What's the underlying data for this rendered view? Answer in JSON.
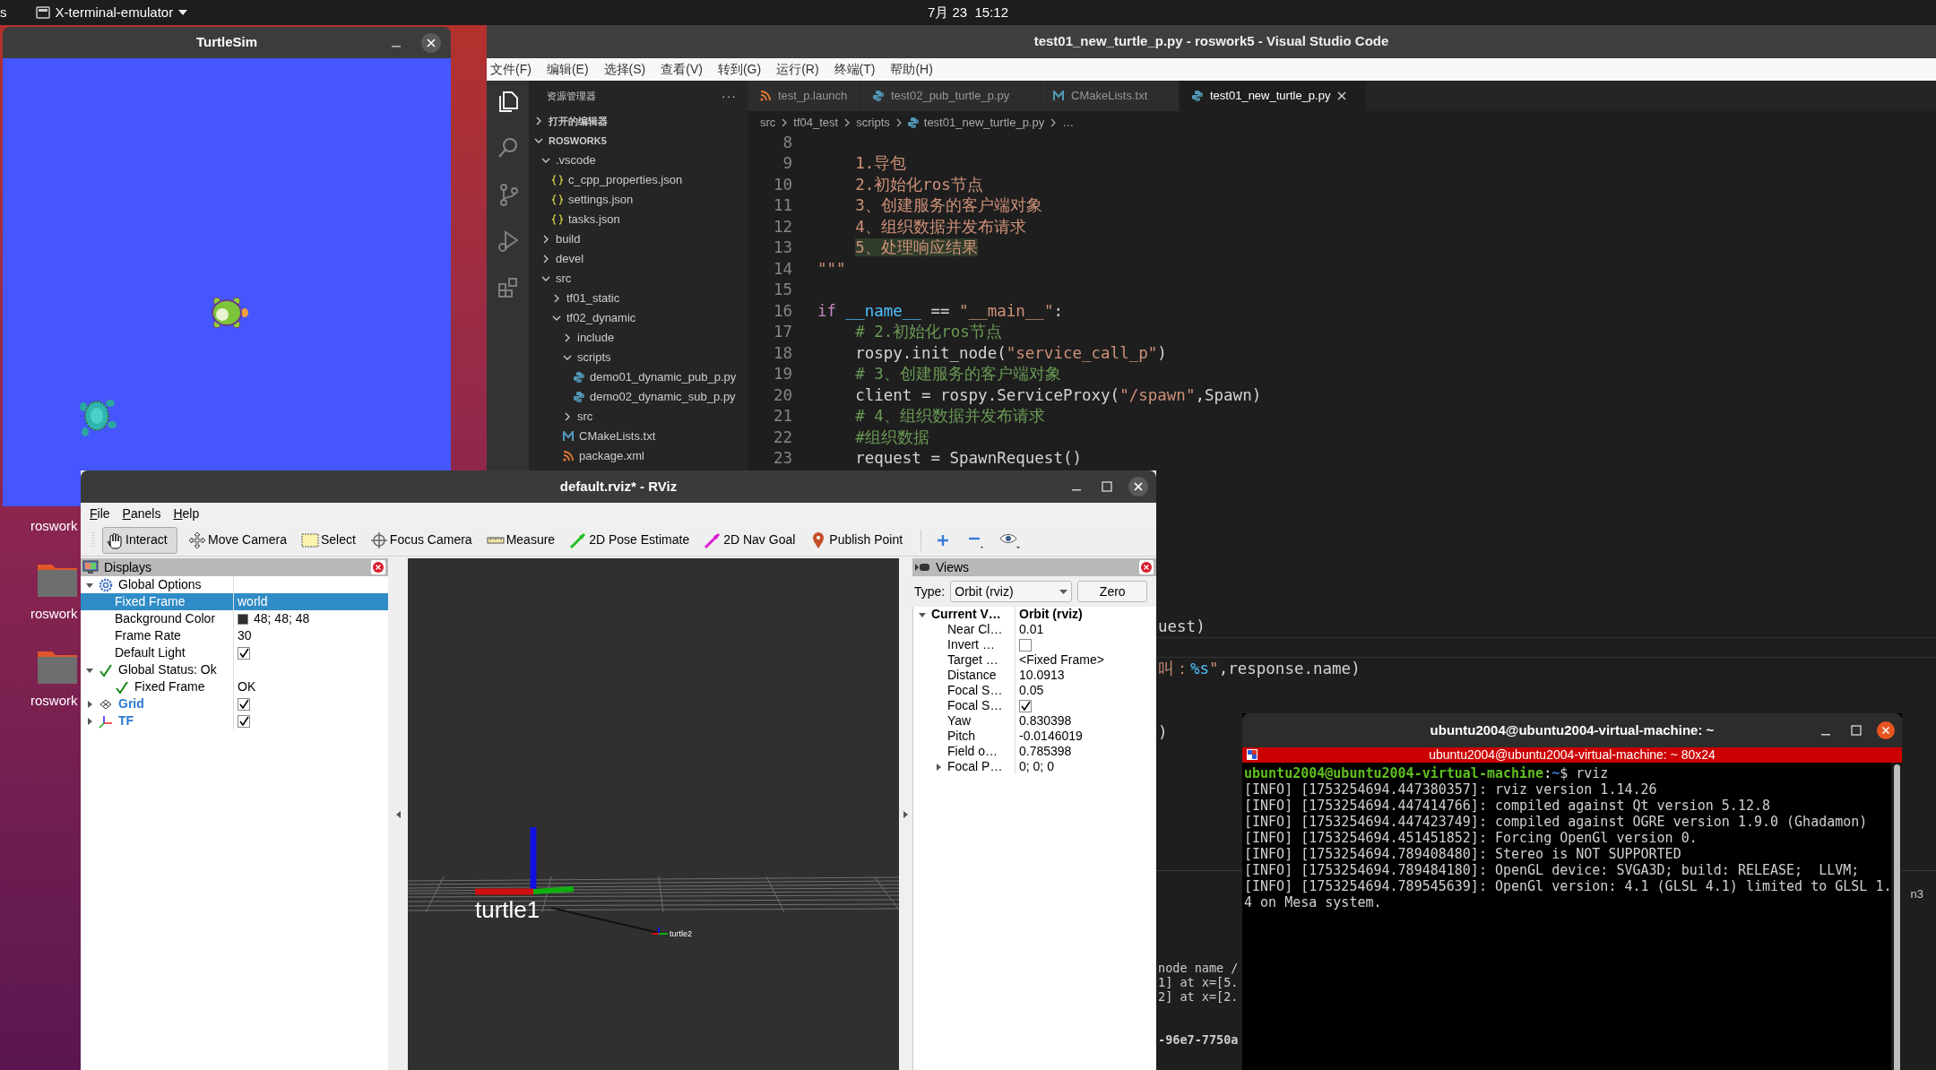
{
  "top_bar": {
    "activities": "s",
    "app_menu": "X-terminal-emulator",
    "clock": "7月 23  15:12"
  },
  "desktop_icons": [
    {
      "label": "roswork",
      "folder": false
    },
    {
      "label": "roswork",
      "folder": true
    },
    {
      "label": "roswork",
      "folder": true
    }
  ],
  "turtlesim": {
    "title": "TurtleSim"
  },
  "vscode": {
    "title": "test01_new_turtle_p.py - roswork5 - Visual Studio Code",
    "menu": [
      "文件(F)",
      "编辑(E)",
      "选择(S)",
      "查看(V)",
      "转到(G)",
      "运行(R)",
      "终端(T)",
      "帮助(H)"
    ],
    "activity": [
      {
        "kind": "files",
        "selected": true
      },
      {
        "kind": "search",
        "selected": false
      },
      {
        "kind": "branch",
        "selected": false
      },
      {
        "kind": "run",
        "selected": false
      },
      {
        "kind": "extensions",
        "selected": false
      }
    ],
    "explorer_title": "资源管理器",
    "more": "···",
    "open_editors": "打开的编辑器",
    "workspace": "ROSWORK5",
    "tree": [
      {
        "label": ".vscode",
        "kind": "folder",
        "expanded": true,
        "children": [
          {
            "label": "c_cpp_properties.json",
            "kind": "json"
          },
          {
            "label": "settings.json",
            "kind": "json"
          },
          {
            "label": "tasks.json",
            "kind": "json"
          }
        ]
      },
      {
        "label": "build",
        "kind": "folder",
        "expanded": false
      },
      {
        "label": "devel",
        "kind": "folder",
        "expanded": false
      },
      {
        "label": "src",
        "kind": "folder",
        "expanded": true,
        "children": [
          {
            "label": "tf01_static",
            "kind": "folder",
            "expanded": false
          },
          {
            "label": "tf02_dynamic",
            "kind": "folder",
            "expanded": true,
            "children": [
              {
                "label": "include",
                "kind": "folder",
                "expanded": false
              },
              {
                "label": "scripts",
                "kind": "folder",
                "expanded": true,
                "children": [
                  {
                    "label": "demo01_dynamic_pub_p.py",
                    "kind": "python"
                  },
                  {
                    "label": "demo02_dynamic_sub_p.py",
                    "kind": "python"
                  }
                ]
              },
              {
                "label": "src",
                "kind": "folder",
                "expanded": false
              },
              {
                "label": "CMakeLists.txt",
                "kind": "cmake"
              },
              {
                "label": "package.xml",
                "kind": "xml"
              }
            ]
          }
        ]
      }
    ],
    "tabs": [
      {
        "label": "test_p.launch",
        "kind": "xml",
        "selected": false
      },
      {
        "label": "test02_pub_turtle_p.py",
        "kind": "python",
        "selected": false
      },
      {
        "label": "CMakeLists.txt",
        "kind": "cmake",
        "selected": false
      },
      {
        "label": "test01_new_turtle_p.py",
        "kind": "python",
        "selected": true
      }
    ],
    "breadcrumb": [
      "src",
      "tf04_test",
      "scripts",
      "test01_new_turtle_p.py",
      "…"
    ],
    "code": [
      {
        "kind": "line",
        "num": "8"
      },
      {
        "kind": "line",
        "num": "9",
        "tokens": [
          {
            "text": "    1.导包",
            "kind": "str"
          }
        ]
      },
      {
        "kind": "line",
        "num": "10",
        "tokens": [
          {
            "text": "    2.初始化ros节点",
            "kind": "str"
          }
        ]
      },
      {
        "kind": "line",
        "num": "11",
        "tokens": [
          {
            "text": "    3、创建服务的客户端对象",
            "kind": "str"
          }
        ]
      },
      {
        "kind": "line",
        "num": "12",
        "tokens": [
          {
            "text": "    4、组织数据并发布请求",
            "kind": "str"
          }
        ]
      },
      {
        "kind": "line",
        "num": "13",
        "tokens": [
          {
            "text": "    5、处理响应结果",
            "kind": "strhl"
          }
        ]
      },
      {
        "kind": "line",
        "num": "14",
        "tokens": [
          {
            "text": "\"\"\"",
            "kind": "str"
          }
        ]
      },
      {
        "kind": "line",
        "num": "15"
      },
      {
        "kind": "line",
        "num": "16",
        "tokens": [
          {
            "text": "if",
            "kind": "kw"
          },
          {
            "text": " __name__",
            "kind": "var"
          },
          {
            "text": " == ",
            "kind": "plain"
          },
          {
            "text": "\"__main__\"",
            "kind": "str"
          },
          {
            "text": ":",
            "kind": "plain"
          }
        ]
      },
      {
        "kind": "line",
        "num": "17",
        "tokens": [
          {
            "text": "    # 2.初始化ros节点",
            "kind": "comment"
          }
        ]
      },
      {
        "kind": "line",
        "num": "18",
        "tokens": [
          {
            "text": "    rospy.init_node(",
            "kind": "plain"
          },
          {
            "text": "\"service_call_p\"",
            "kind": "str"
          },
          {
            "text": ")",
            "kind": "plain"
          }
        ]
      },
      {
        "kind": "line",
        "num": "19",
        "tokens": [
          {
            "text": "    # 3、创建服务的客户端对象",
            "kind": "comment"
          }
        ]
      },
      {
        "kind": "line",
        "num": "20",
        "tokens": [
          {
            "text": "    client = rospy.ServiceProxy(",
            "kind": "plain"
          },
          {
            "text": "\"/spawn\"",
            "kind": "str"
          },
          {
            "text": ",Spawn)",
            "kind": "plain"
          }
        ]
      },
      {
        "kind": "line",
        "num": "21",
        "tokens": [
          {
            "text": "    # 4、组织数据并发布请求",
            "kind": "comment"
          }
        ]
      },
      {
        "kind": "line",
        "num": "22",
        "tokens": [
          {
            "text": "    #组织数据",
            "kind": "comment"
          }
        ]
      },
      {
        "kind": "line",
        "num": "23",
        "tokens": [
          {
            "text": "    request = SpawnRequest()",
            "kind": "plain"
          }
        ]
      },
      {
        "kind": "hidden"
      },
      {
        "kind": "hidden"
      },
      {
        "kind": "hidden"
      },
      {
        "kind": "hidden"
      },
      {
        "kind": "hidden"
      },
      {
        "kind": "hidden"
      },
      {
        "kind": "hidden"
      },
      {
        "kind": "tail",
        "tokens": [
          {
            "text": "uest)",
            "kind": "plain"
          }
        ]
      },
      {
        "kind": "current"
      },
      {
        "kind": "tail",
        "tokens": [
          {
            "text": "叫：",
            "kind": "str"
          },
          {
            "text": "%s",
            "kind": "var"
          },
          {
            "text": "\"",
            "kind": "str"
          },
          {
            "text": ",response.name)",
            "kind": "plain"
          }
        ]
      },
      {
        "kind": "hidden"
      },
      {
        "kind": "hidden"
      },
      {
        "kind": "tail",
        "tokens": [
          {
            "text": ")",
            "kind": "plain"
          }
        ]
      }
    ],
    "panel_lines": [
      {
        "kind": "text",
        "text": "node name /"
      },
      {
        "kind": "text",
        "text": "1] at x=[5."
      },
      {
        "kind": "text",
        "text": "2] at x=[2."
      },
      {
        "kind": "blank"
      },
      {
        "kind": "blank"
      },
      {
        "kind": "bold",
        "text": "-96e7-7750a"
      }
    ],
    "panel_side_label": "n3"
  },
  "rviz": {
    "title": "default.rviz* - RViz",
    "menu": [
      "File",
      "Panels",
      "Help"
    ],
    "tools": [
      {
        "label": "Interact",
        "kind": "hand",
        "selected": true
      },
      {
        "label": "Move Camera",
        "kind": "move",
        "selected": false
      },
      {
        "label": "Select",
        "kind": "select",
        "selected": false
      },
      {
        "label": "Focus Camera",
        "kind": "focus",
        "selected": false
      },
      {
        "label": "Measure",
        "kind": "ruler",
        "selected": false
      },
      {
        "label": "2D Pose Estimate",
        "kind": "pose",
        "selected": false
      },
      {
        "label": "2D Nav Goal",
        "kind": "goal",
        "selected": false
      },
      {
        "label": "Publish Point",
        "kind": "pin",
        "selected": false
      }
    ],
    "displays": {
      "title": "Displays",
      "rows": [
        {
          "label": "Global Options",
          "expanded": true,
          "selected": false,
          "children": [
            {
              "label": "Fixed Frame",
              "kind": "text",
              "value": "world",
              "selected": true
            },
            {
              "label": "Background Color",
              "kind": "color",
              "value": "48; 48; 48",
              "color": "#303030",
              "selected": false
            },
            {
              "label": "Frame Rate",
              "kind": "text",
              "value": "30",
              "selected": false
            },
            {
              "label": "Default Light",
              "kind": "checkbox",
              "checked": true,
              "selected": false
            }
          ]
        },
        {
          "label": "Global Status: Ok",
          "expanded": true,
          "selected": false,
          "children": [
            {
              "label": "Fixed Frame",
              "kind": "text",
              "value": "OK",
              "selected": false
            }
          ]
        },
        {
          "label": "Grid",
          "kind": "checkbox",
          "checked": true,
          "expanded": false,
          "emphasis": true,
          "selected": false
        },
        {
          "label": "TF",
          "kind": "checkbox",
          "checked": true,
          "expanded": false,
          "emphasis": true,
          "selected": false
        }
      ]
    },
    "canvas": {
      "frames": [
        {
          "label": "turtle1",
          "kind": "large"
        },
        {
          "label": "turtle2",
          "kind": "small"
        }
      ]
    },
    "views": {
      "title": "Views",
      "type_label": "Type:",
      "type_value": "Orbit (rviz)",
      "zero": "Zero",
      "rows": [
        {
          "label": "Current V…",
          "value": "Orbit (rviz)",
          "kind": "text",
          "expanded": true,
          "children": [
            {
              "label": "Near Cl…",
              "kind": "text",
              "value": "0.01"
            },
            {
              "label": "Invert …",
              "kind": "checkbox",
              "checked": false
            },
            {
              "label": "Target …",
              "kind": "text",
              "value": "<Fixed Frame>"
            },
            {
              "label": "Distance",
              "kind": "text",
              "value": "10.0913"
            },
            {
              "label": "Focal S…",
              "kind": "text",
              "value": "0.05"
            },
            {
              "label": "Focal S…",
              "kind": "checkbox",
              "checked": true
            },
            {
              "label": "Yaw",
              "kind": "text",
              "value": "0.830398"
            },
            {
              "label": "Pitch",
              "kind": "text",
              "value": "-0.0146019"
            },
            {
              "label": "Field o…",
              "kind": "text",
              "value": "0.785398"
            },
            {
              "label": "Focal P…",
              "kind": "text",
              "value": "0; 0; 0",
              "expanded": false
            }
          ]
        }
      ]
    }
  },
  "terminal": {
    "title": "ubuntu2004@ubuntu2004-virtual-machine: ~",
    "tab": "ubuntu2004@ubuntu2004-virtual-machine: ~ 80x24",
    "prompt": {
      "user": "ubuntu2004@ubuntu2004-virtual-machine",
      "sep": ":",
      "dir": "~",
      "cmd": "$ rviz"
    },
    "lines": [
      "[INFO] [1753254694.447380357]: rviz version 1.14.26",
      "[INFO] [1753254694.447414766]: compiled against Qt version 5.12.8",
      "[INFO] [1753254694.447423749]: compiled against OGRE version 1.9.0 (Ghadamon)",
      "[INFO] [1753254694.451451852]: Forcing OpenGl version 0.",
      "[INFO] [1753254694.789408480]: Stereo is NOT SUPPORTED",
      "[INFO] [1753254694.789484180]: OpenGL device: SVGA3D; build: RELEASE;  LLVM;",
      "[INFO] [1753254694.789545639]: OpenGl version: 4.1 (GLSL 4.1) limited to GLSL 1.",
      "4 on Mesa system."
    ]
  }
}
